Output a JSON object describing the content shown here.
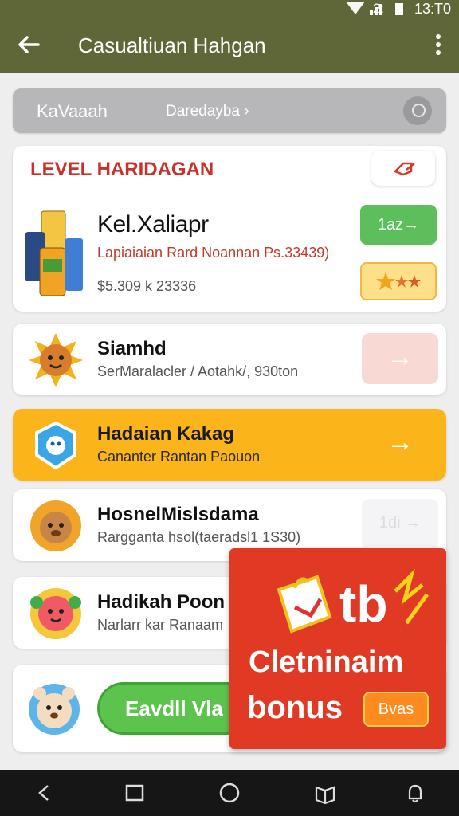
{
  "status_bar": {
    "signal_num": "2:",
    "time": "13:T0"
  },
  "app_bar": {
    "title": "Casualtiuan Hahgan"
  },
  "search": {
    "label": "KaVaaah",
    "breadcrumb": "Daredayba ›"
  },
  "level_card": {
    "heading": "LEVEL HARIDAGAN",
    "product_name": "Kel.Xaliapr",
    "description": "Lapiaiaian Rard Noannan Ps.33439)",
    "price": "$5.309  k 23336",
    "go_label": "1az→"
  },
  "rows": [
    {
      "title": "Siamhd",
      "subtitle": "SerMaralacler / Aotahk/, 930ton",
      "action": "→"
    },
    {
      "title": "Hadaian Kakag",
      "subtitle": "Cananter Rantan Paouon",
      "action": "→"
    },
    {
      "title": "HosnelMislsdama",
      "subtitle": "Rargganta hsol(taeradsl1 1S30)",
      "action": "1di →"
    },
    {
      "title": "Hadikah Poon",
      "subtitle": "Narlarr kar Ranaam"
    }
  ],
  "bottom_card": {
    "button_label": "Eavdll  Vla"
  },
  "promo": {
    "line1": "Cletninaim",
    "line2": "bonus",
    "badge": "Bvas",
    "graphic_text": "tb"
  },
  "colors": {
    "app_bar": "#5f6738",
    "highlight_row": "#fbb51a",
    "promo": "#e03a24",
    "go_button": "#5cbf5c",
    "heading": "#c8322b"
  }
}
